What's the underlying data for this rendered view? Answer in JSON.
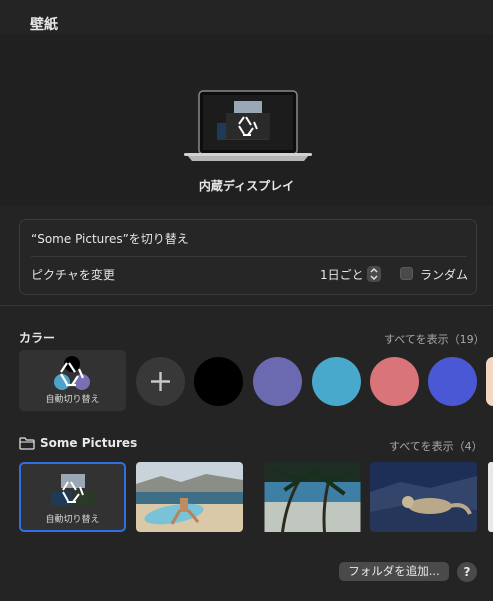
{
  "window": {
    "title": "壁紙"
  },
  "display": {
    "label": "内蔵ディスプレイ"
  },
  "rotation": {
    "title": "“Some Pictures”を切り替え",
    "change_label": "ピクチャを変更",
    "frequency": "1日ごと",
    "random_label": "ランダム",
    "random_checked": false
  },
  "colors": {
    "title": "カラー",
    "show_all": "すべてを表示（19）",
    "auto_label": "自動切り替え",
    "swatches": [
      "#000000",
      "#6b6ab0",
      "#48a9cc",
      "#d9747b",
      "#4a58d6",
      "#f1d7c4"
    ]
  },
  "folder": {
    "title": "Some Pictures",
    "show_all": "すべてを表示（4）",
    "auto_label": "自動切り替え",
    "pictures": [
      "surfer-beach",
      "palm-beach",
      "snow-leopard"
    ]
  },
  "buttons": {
    "add_folder": "フォルダを追加...",
    "help": "?"
  },
  "icons": [
    "recycle-icon",
    "laptop-icon",
    "folder-icon",
    "plus-icon",
    "stepper-icon"
  ]
}
